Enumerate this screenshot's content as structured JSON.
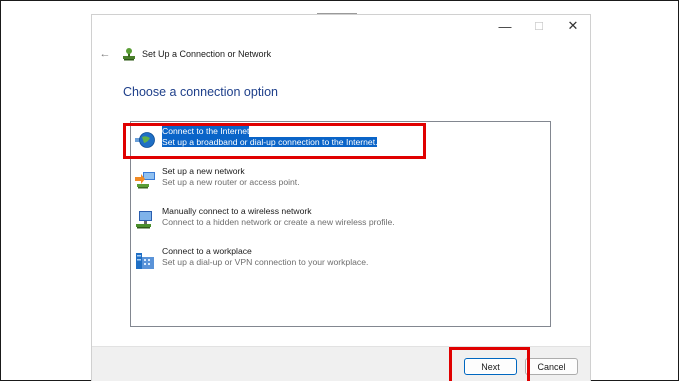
{
  "window": {
    "title": "Set Up a Connection or Network",
    "controls": {
      "minimize": "—",
      "maximize": "☐",
      "close": "✕"
    }
  },
  "navigation": {
    "back_icon": "←"
  },
  "heading": "Choose a connection option",
  "options": [
    {
      "title": "Connect to the Internet",
      "description": "Set up a broadband or dial-up connection to the Internet.",
      "icon": "globe-network-icon",
      "selected": true
    },
    {
      "title": "Set up a new network",
      "description": "Set up a new router or access point.",
      "icon": "router-setup-icon",
      "selected": false
    },
    {
      "title": "Manually connect to a wireless network",
      "description": "Connect to a hidden network or create a new wireless profile.",
      "icon": "wireless-computer-icon",
      "selected": false
    },
    {
      "title": "Connect to a workplace",
      "description": "Set up a dial-up or VPN connection to your workplace.",
      "icon": "workplace-building-icon",
      "selected": false
    }
  ],
  "buttons": {
    "next": "Next",
    "cancel": "Cancel"
  },
  "colors": {
    "selection": "#0a64c8",
    "heading": "#1e3f8a",
    "annotation": "#e00000",
    "footer": "#f0f0f0"
  }
}
